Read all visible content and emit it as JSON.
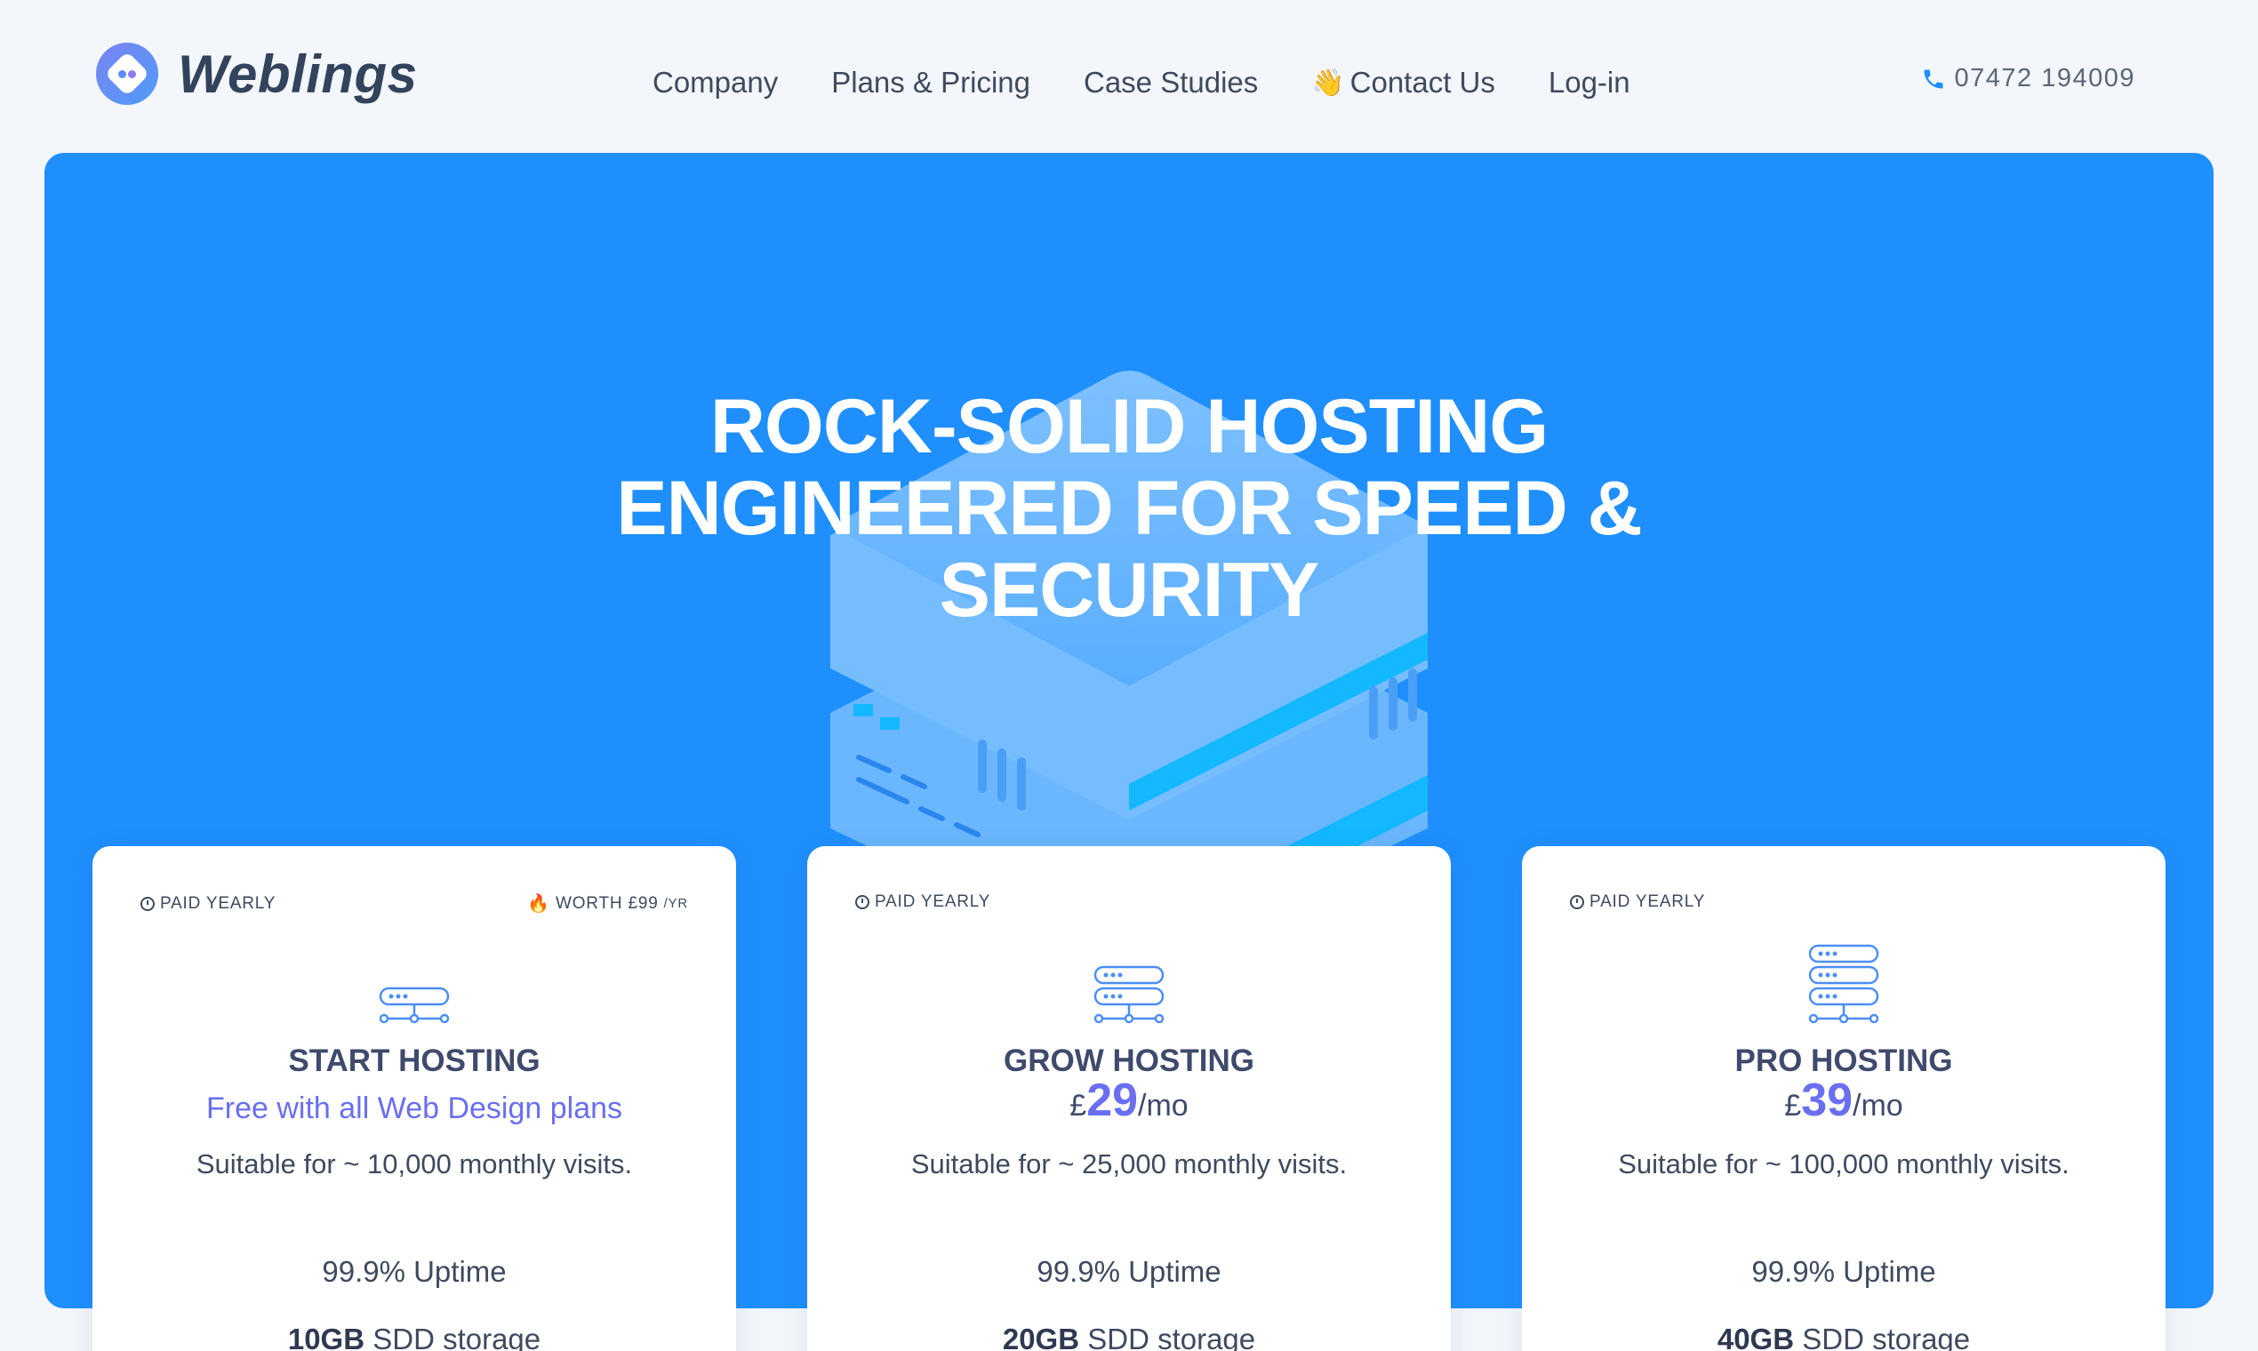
{
  "brand": {
    "name": "Weblings"
  },
  "nav": {
    "items": [
      {
        "label": "Company",
        "icon": ""
      },
      {
        "label": "Plans & Pricing",
        "icon": ""
      },
      {
        "label": "Case Studies",
        "icon": ""
      },
      {
        "label": "Contact Us",
        "icon": "waving-hand-icon"
      },
      {
        "label": "Log-in",
        "icon": ""
      }
    ]
  },
  "contact": {
    "phone": "07472 194009",
    "icon": "phone-icon"
  },
  "hero": {
    "title_lines": [
      "ROCK-SOLID HOSTING",
      "ENGINEERED FOR SPEED &",
      "SECURITY"
    ],
    "background": "#1f8ffe"
  },
  "plans": [
    {
      "billing": "PAID YEARLY",
      "worth": "WORTH £99",
      "worth_unit": "/YR",
      "name": "START HOSTING",
      "free_text": "Free with all Web Design plans",
      "currency": "",
      "price": "",
      "period": "",
      "visits": "Suitable for ~ 10,000 monthly visits.",
      "uptime": "99.9% Uptime",
      "storage_amount": "10GB",
      "storage_label": " SDD storage",
      "server_units": 1
    },
    {
      "billing": "PAID YEARLY",
      "worth": "",
      "worth_unit": "",
      "name": "GROW HOSTING",
      "free_text": "",
      "currency": "£",
      "price": "29",
      "period": "/mo",
      "visits": "Suitable for ~ 25,000 monthly visits.",
      "uptime": "99.9% Uptime",
      "storage_amount": "20GB",
      "storage_label": " SDD storage",
      "server_units": 2
    },
    {
      "billing": "PAID YEARLY",
      "worth": "",
      "worth_unit": "",
      "name": "PRO HOSTING",
      "free_text": "",
      "currency": "£",
      "price": "39",
      "period": "/mo",
      "visits": "Suitable for ~ 100,000 monthly visits.",
      "uptime": "99.9% Uptime",
      "storage_amount": "40GB",
      "storage_label": " SDD storage",
      "server_units": 3
    }
  ],
  "colors": {
    "accent": "#6a6ff0",
    "hero_blue": "#1f8ffe",
    "text": "#3f4a5e",
    "page_bg": "#f3f6fa"
  }
}
